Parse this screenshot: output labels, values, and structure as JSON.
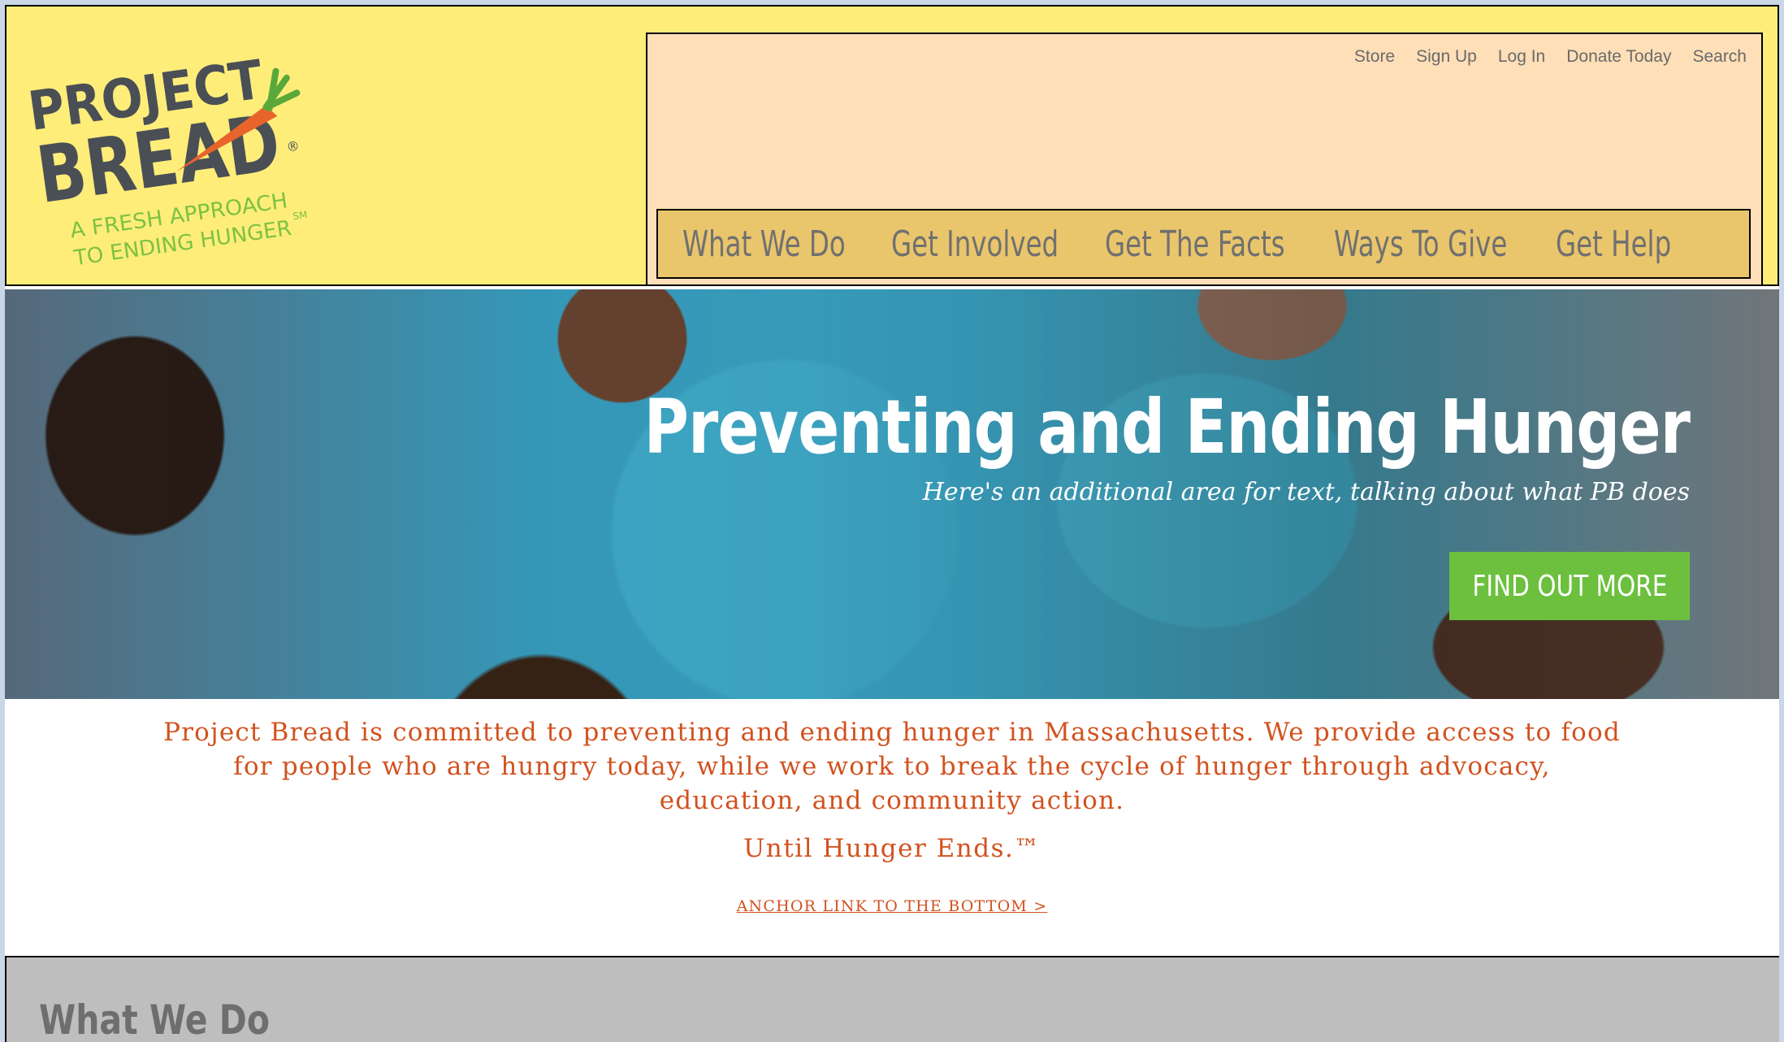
{
  "logo": {
    "line1": "PROJECT",
    "line2": "BREAD",
    "tagline1": "A FRESH APPROACH",
    "tagline2": "TO ENDING HUNGER",
    "trademark": "SM",
    "registered": "®",
    "icon": "carrot-icon"
  },
  "utility_nav": [
    "Store",
    "Sign Up",
    "Log In",
    "Donate Today",
    "Search"
  ],
  "main_nav": [
    "What We Do",
    "Get Involved",
    "Get The Facts",
    "Ways To Give",
    "Get Help"
  ],
  "hero": {
    "title": "Preventing and Ending Hunger",
    "subtitle": "Here's an additional area for text, talking about what PB does",
    "button": "FIND OUT MORE"
  },
  "mission": {
    "text": "Project Bread is committed to preventing and ending hunger in Massachusetts. We provide access to food for people who are hungry today, while we work to break the cycle of hunger through advocacy, education, and community action.",
    "tagline": "Until Hunger Ends.™",
    "anchor_link": "ANCHOR LINK TO THE BOTTOM >"
  },
  "section": {
    "title": "What We Do"
  },
  "colors": {
    "header_bg": "#ffed7a",
    "nav_box_bg": "#ffdfb7",
    "main_nav_bg": "#e9c56c",
    "accent_orange": "#d2521f",
    "button_green": "#6cc03e",
    "section_bg": "#bebebe"
  }
}
